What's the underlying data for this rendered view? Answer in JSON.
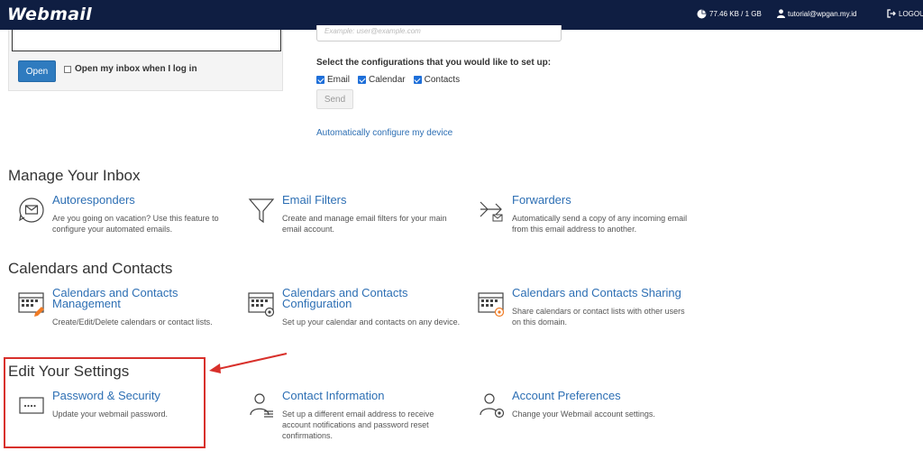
{
  "header": {
    "brand": "Webmail",
    "disk_usage": "77.46 KB / 1 GB",
    "user_email": "tutorial@wpgan.my.id",
    "logout_label": "LOGOUT"
  },
  "open_panel": {
    "open_button": "Open",
    "open_inbox_label": "Open my inbox when I log in"
  },
  "configure": {
    "email_placeholder": "Example: user@example.com",
    "select_label": "Select the configurations that you would like to set up:",
    "options": [
      {
        "label": "Email",
        "checked": true
      },
      {
        "label": "Calendar",
        "checked": true
      },
      {
        "label": "Contacts",
        "checked": true
      }
    ],
    "send_button": "Send",
    "auto_link": "Automatically configure my device"
  },
  "sections": {
    "inbox": {
      "title": "Manage Your Inbox",
      "tools": [
        {
          "title": "Autoresponders",
          "desc": "Are you going on vacation? Use this feature to configure your automated emails.",
          "icon": "autoresponder-icon"
        },
        {
          "title": "Email Filters",
          "desc": "Create and manage email filters for your main email account.",
          "icon": "filter-icon"
        },
        {
          "title": "Forwarders",
          "desc": "Automatically send a copy of any incoming email from this email address to another.",
          "icon": "forwarder-icon"
        }
      ]
    },
    "calendars": {
      "title": "Calendars and Contacts",
      "tools": [
        {
          "title": "Calendars and Contacts Management",
          "desc": "Create/Edit/Delete calendars or contact lists.",
          "icon": "calendar-management-icon"
        },
        {
          "title": "Calendars and Contacts Configuration",
          "desc": "Set up your calendar and contacts on any device.",
          "icon": "calendar-configuration-icon"
        },
        {
          "title": "Calendars and Contacts Sharing",
          "desc": "Share calendars or contact lists with other users on this domain.",
          "icon": "calendar-sharing-icon"
        }
      ]
    },
    "settings": {
      "title": "Edit Your Settings",
      "tools": [
        {
          "title": "Password & Security",
          "desc": "Update your webmail password.",
          "icon": "password-icon"
        },
        {
          "title": "Contact Information",
          "desc": "Set up a different email address to receive account notifications and password reset confirmations.",
          "icon": "contact-info-icon"
        },
        {
          "title": "Account Preferences",
          "desc": "Change your Webmail account settings.",
          "icon": "account-preferences-icon"
        }
      ]
    }
  },
  "colors": {
    "topbar": "#0f1e42",
    "link": "#2d6fb4",
    "primary_button": "#2f7bbf",
    "highlight": "#d8302b",
    "icon_orange": "#f07b24"
  }
}
